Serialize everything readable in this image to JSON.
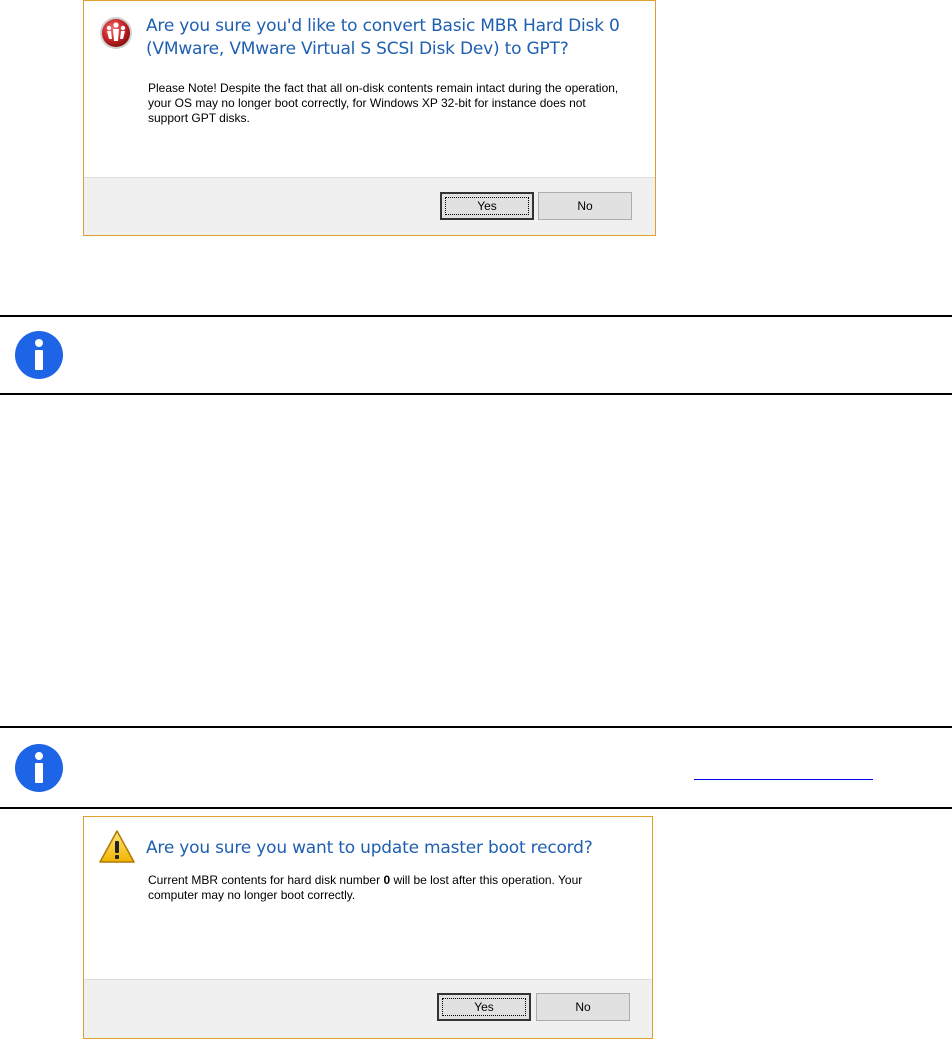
{
  "dialogs": [
    {
      "icon": "paragon-logo-icon",
      "title": "Are you sure you'd like to convert Basic MBR Hard Disk 0 (VMware, VMware Virtual S SCSI Disk Dev) to GPT?",
      "message": "Please Note! Despite the fact that all on-disk contents remain intact during the operation, your OS may no longer boot correctly, for Windows XP 32-bit for instance does not support GPT disks.",
      "yes_label": "Yes",
      "no_label": "No"
    },
    {
      "icon": "warning-icon",
      "title": "Are you sure you want to update master boot record?",
      "message_before": "Current MBR contents for hard disk number ",
      "message_bold": "0",
      "message_after": " will be lost after this operation. Your computer may no longer boot correctly.",
      "yes_label": "Yes",
      "no_label": "No"
    }
  ],
  "notes": [
    {
      "icon": "info-icon",
      "text": ""
    },
    {
      "icon": "info-icon",
      "text": "",
      "link_text": ""
    }
  ],
  "colors": {
    "dialog_title": "#1f5fb0",
    "dialog_border": "#e0a030",
    "info_icon": "#1e64e6",
    "link": "#0000ee"
  }
}
